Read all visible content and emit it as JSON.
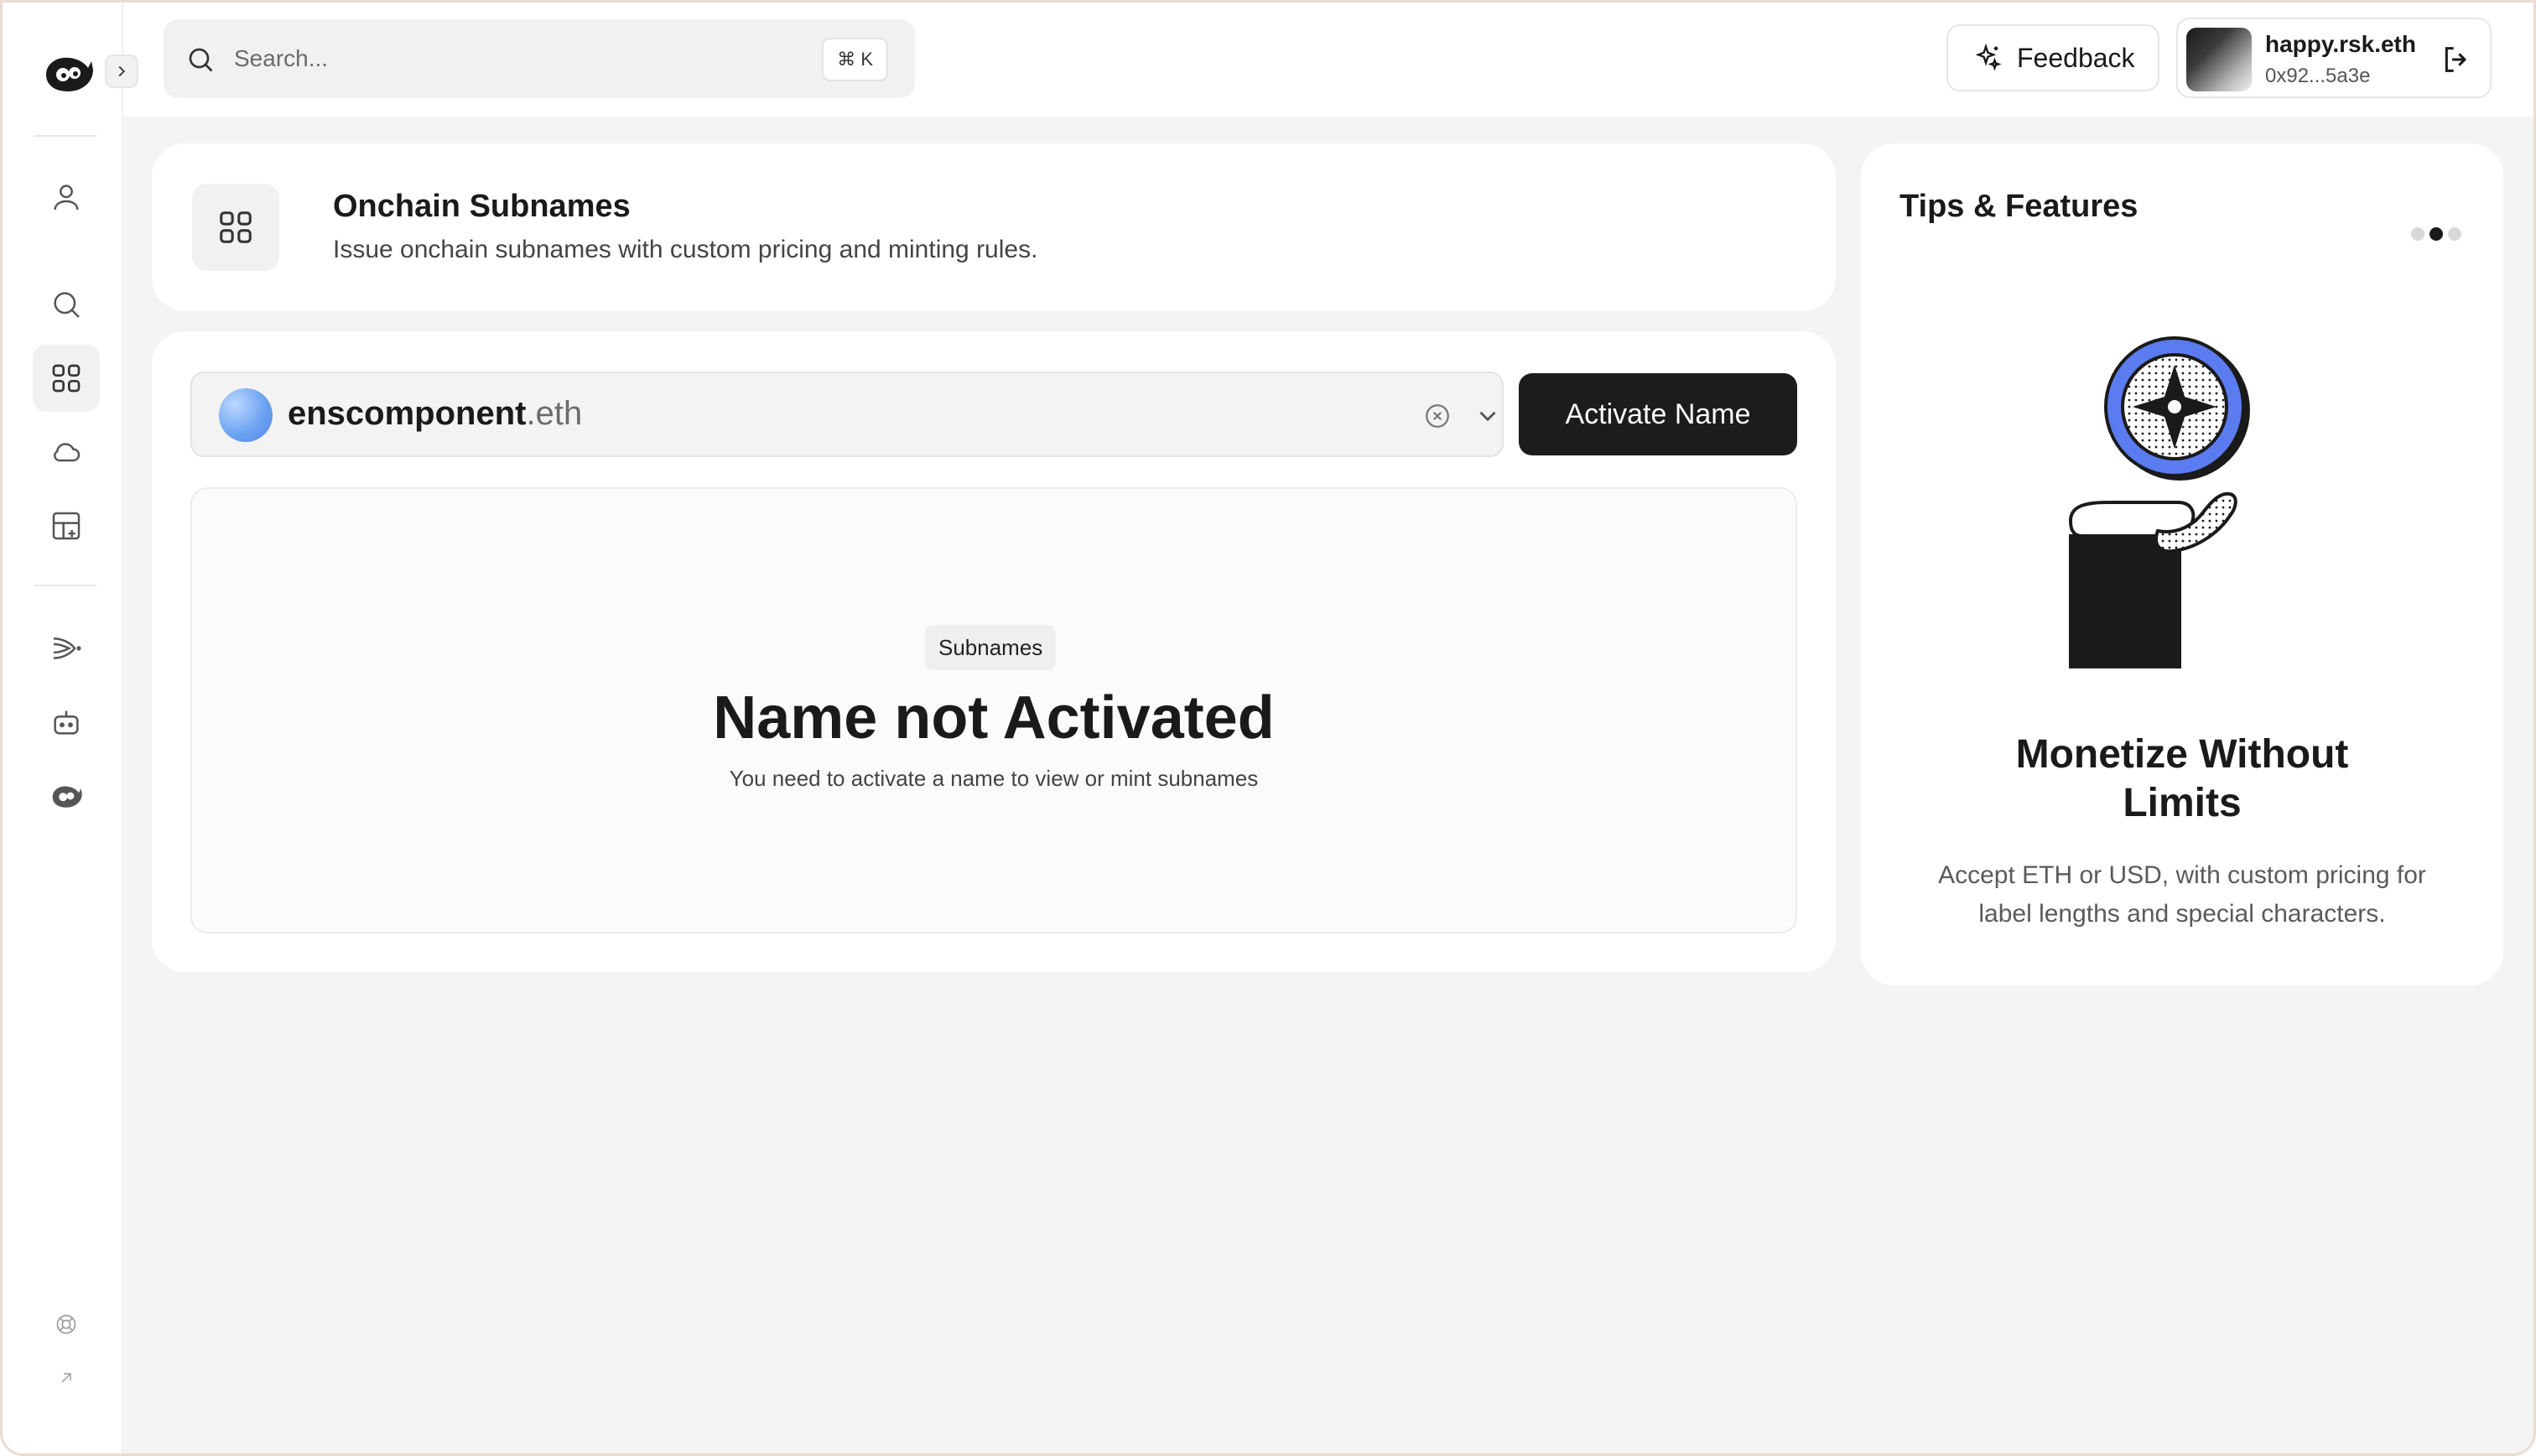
{
  "search": {
    "placeholder": "Search...",
    "shortcut": "⌘ K"
  },
  "topbar": {
    "feedback_label": "Feedback",
    "account_name": "happy.rsk.eth",
    "account_address": "0x92...5a3e"
  },
  "sidebar": {
    "items": [
      {
        "name": "profile",
        "icon": "user-icon"
      },
      {
        "name": "search",
        "icon": "search-icon"
      },
      {
        "name": "subnames",
        "icon": "grid-icon",
        "active": true
      },
      {
        "name": "cloud",
        "icon": "cloud-icon"
      },
      {
        "name": "add-widget",
        "icon": "grid-plus-icon"
      },
      {
        "name": "send",
        "icon": "send-icon"
      },
      {
        "name": "bot",
        "icon": "bot-icon"
      },
      {
        "name": "brand",
        "icon": "logo-icon"
      },
      {
        "name": "help",
        "icon": "help-icon"
      },
      {
        "name": "external",
        "icon": "arrow-up-right-icon"
      }
    ]
  },
  "header": {
    "title": "Onchain Subnames",
    "subtitle": "Issue onchain subnames with custom pricing and minting rules."
  },
  "name_select": {
    "name": "enscomponent",
    "tld": ".eth"
  },
  "activate_label": "Activate Name",
  "empty_state": {
    "badge": "Subnames",
    "title": "Name not Activated",
    "description": "You need to activate a name to view or mint subnames"
  },
  "tips": {
    "title": "Tips & Features",
    "headline": "Monetize Without Limits",
    "body": "Accept ETH or USD, with custom pricing for label lengths and special characters."
  },
  "colors": {
    "accent_blue": "#5b7cf0",
    "dark_button": "#1c1c1c",
    "panel_bg": "#f4f4f4"
  }
}
